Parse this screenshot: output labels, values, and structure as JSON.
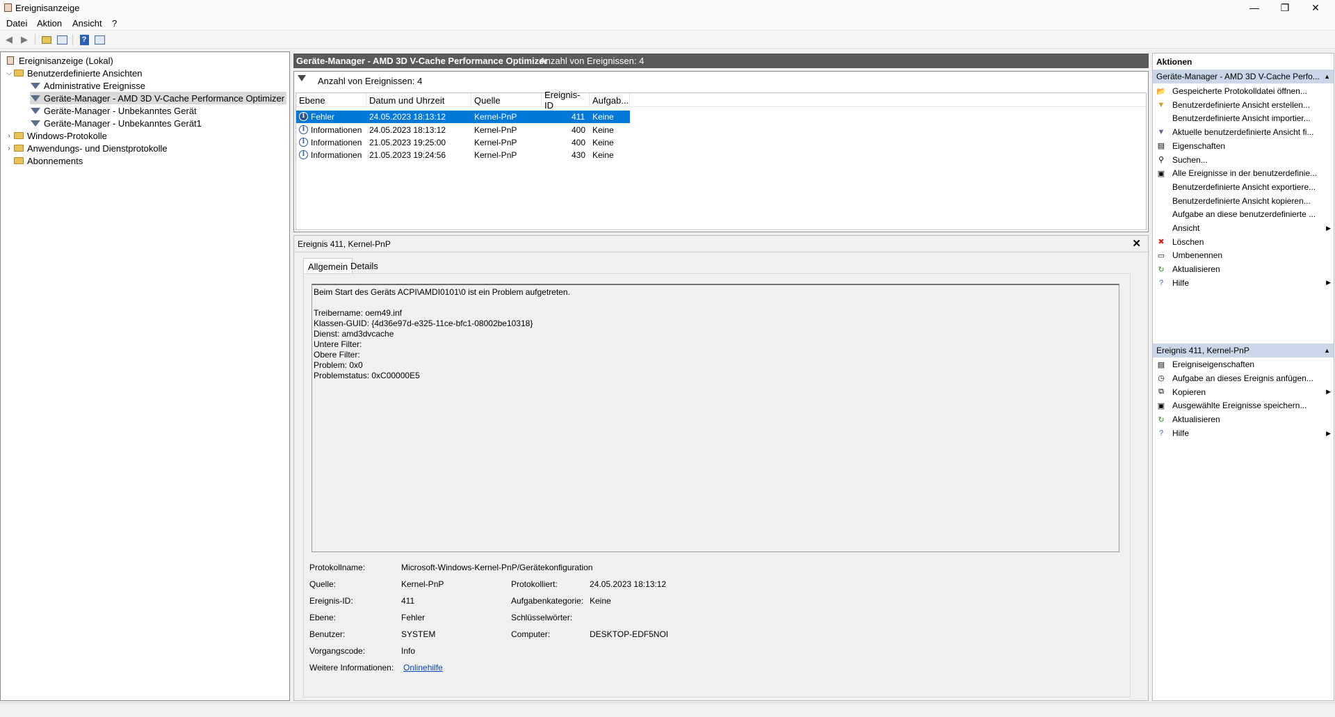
{
  "window": {
    "title": "Ereignisanzeige",
    "min": "—",
    "max": "❐",
    "close": "✕"
  },
  "menu": [
    "Datei",
    "Aktion",
    "Ansicht",
    "?"
  ],
  "tree": {
    "root": "Ereignisanzeige (Lokal)",
    "custom_views": "Benutzerdefinierte Ansichten",
    "admin_events": "Administrative Ereignisse",
    "view_amd": "Geräte-Manager - AMD 3D V-Cache Performance Optimizer",
    "view_unknown": "Geräte-Manager - Unbekanntes Gerät",
    "view_unknown1": "Geräte-Manager - Unbekanntes Gerät1",
    "windows_logs": "Windows-Protokolle",
    "app_logs": "Anwendungs- und Dienstprotokolle",
    "subscriptions": "Abonnements"
  },
  "center": {
    "title": "Geräte-Manager - AMD 3D V-Cache Performance Optimizer",
    "count": "Anzahl von Ereignissen: 4",
    "filter_count": "Anzahl von Ereignissen: 4",
    "columns": [
      "Ebene",
      "Datum und Uhrzeit",
      "Quelle",
      "Ereignis-ID",
      "Aufgab..."
    ],
    "rows": [
      {
        "level": "Fehler",
        "date": "24.05.2023 18:13:12",
        "source": "Kernel-PnP",
        "id": "411",
        "task": "Keine",
        "icon": "error-icon"
      },
      {
        "level": "Informationen",
        "date": "24.05.2023 18:13:12",
        "source": "Kernel-PnP",
        "id": "400",
        "task": "Keine",
        "icon": "info-icon"
      },
      {
        "level": "Informationen",
        "date": "21.05.2023 19:25:00",
        "source": "Kernel-PnP",
        "id": "400",
        "task": "Keine",
        "icon": "info-icon"
      },
      {
        "level": "Informationen",
        "date": "21.05.2023 19:24:56",
        "source": "Kernel-PnP",
        "id": "430",
        "task": "Keine",
        "icon": "info-icon"
      }
    ]
  },
  "detail": {
    "header": "Ereignis 411, Kernel-PnP",
    "tab_general": "Allgemein",
    "tab_details": "Details",
    "message": "Beim Start des Geräts ACPI\\AMDI0101\\0 ist ein Problem aufgetreten.\n\nTreibername: oem49.inf\nKlassen-GUID: {4d36e97d-e325-11ce-bfc1-08002be10318}\nDienst: amd3dvcache\nUntere Filter: \nObere Filter: \nProblem: 0x0\nProblemstatus: 0xC00000E5",
    "labels": {
      "log": "Protokollname:",
      "source": "Quelle:",
      "logged": "Protokolliert:",
      "event_id": "Ereignis-ID:",
      "task_cat": "Aufgabenkategorie:",
      "level": "Ebene:",
      "keywords": "Schlüsselwörter:",
      "user": "Benutzer:",
      "computer": "Computer:",
      "opcode": "Vorgangscode:",
      "more_info": "Weitere Informationen:"
    },
    "values": {
      "log": "Microsoft-Windows-Kernel-PnP/Gerätekonfiguration",
      "source": "Kernel-PnP",
      "logged": "24.05.2023 18:13:12",
      "event_id": "411",
      "task_cat": "Keine",
      "level": "Fehler",
      "keywords": "",
      "user": "SYSTEM",
      "computer": "DESKTOP-EDF5NOI",
      "opcode": "Info",
      "more_info": "Onlinehilfe"
    }
  },
  "actions": {
    "title": "Aktionen",
    "sec1": "Geräte-Manager - AMD 3D V-Cache Perfo...",
    "items1": [
      "Gespeicherte Protokolldatei öffnen...",
      "Benutzerdefinierte Ansicht erstellen...",
      "Benutzerdefinierte Ansicht importier...",
      "Aktuelle benutzerdefinierte Ansicht fi...",
      "Eigenschaften",
      "Suchen...",
      "Alle Ereignisse in der benutzerdefinie...",
      "Benutzerdefinierte Ansicht exportiere...",
      "Benutzerdefinierte Ansicht kopieren...",
      "Aufgabe an diese benutzerdefinierte ...",
      "Ansicht",
      "Löschen",
      "Umbenennen",
      "Aktualisieren",
      "Hilfe"
    ],
    "sec2": "Ereignis 411, Kernel-PnP",
    "items2": [
      "Ereigniseigenschaften",
      "Aufgabe an dieses Ereignis anfügen...",
      "Kopieren",
      "Ausgewählte Ereignisse speichern...",
      "Aktualisieren",
      "Hilfe"
    ]
  }
}
